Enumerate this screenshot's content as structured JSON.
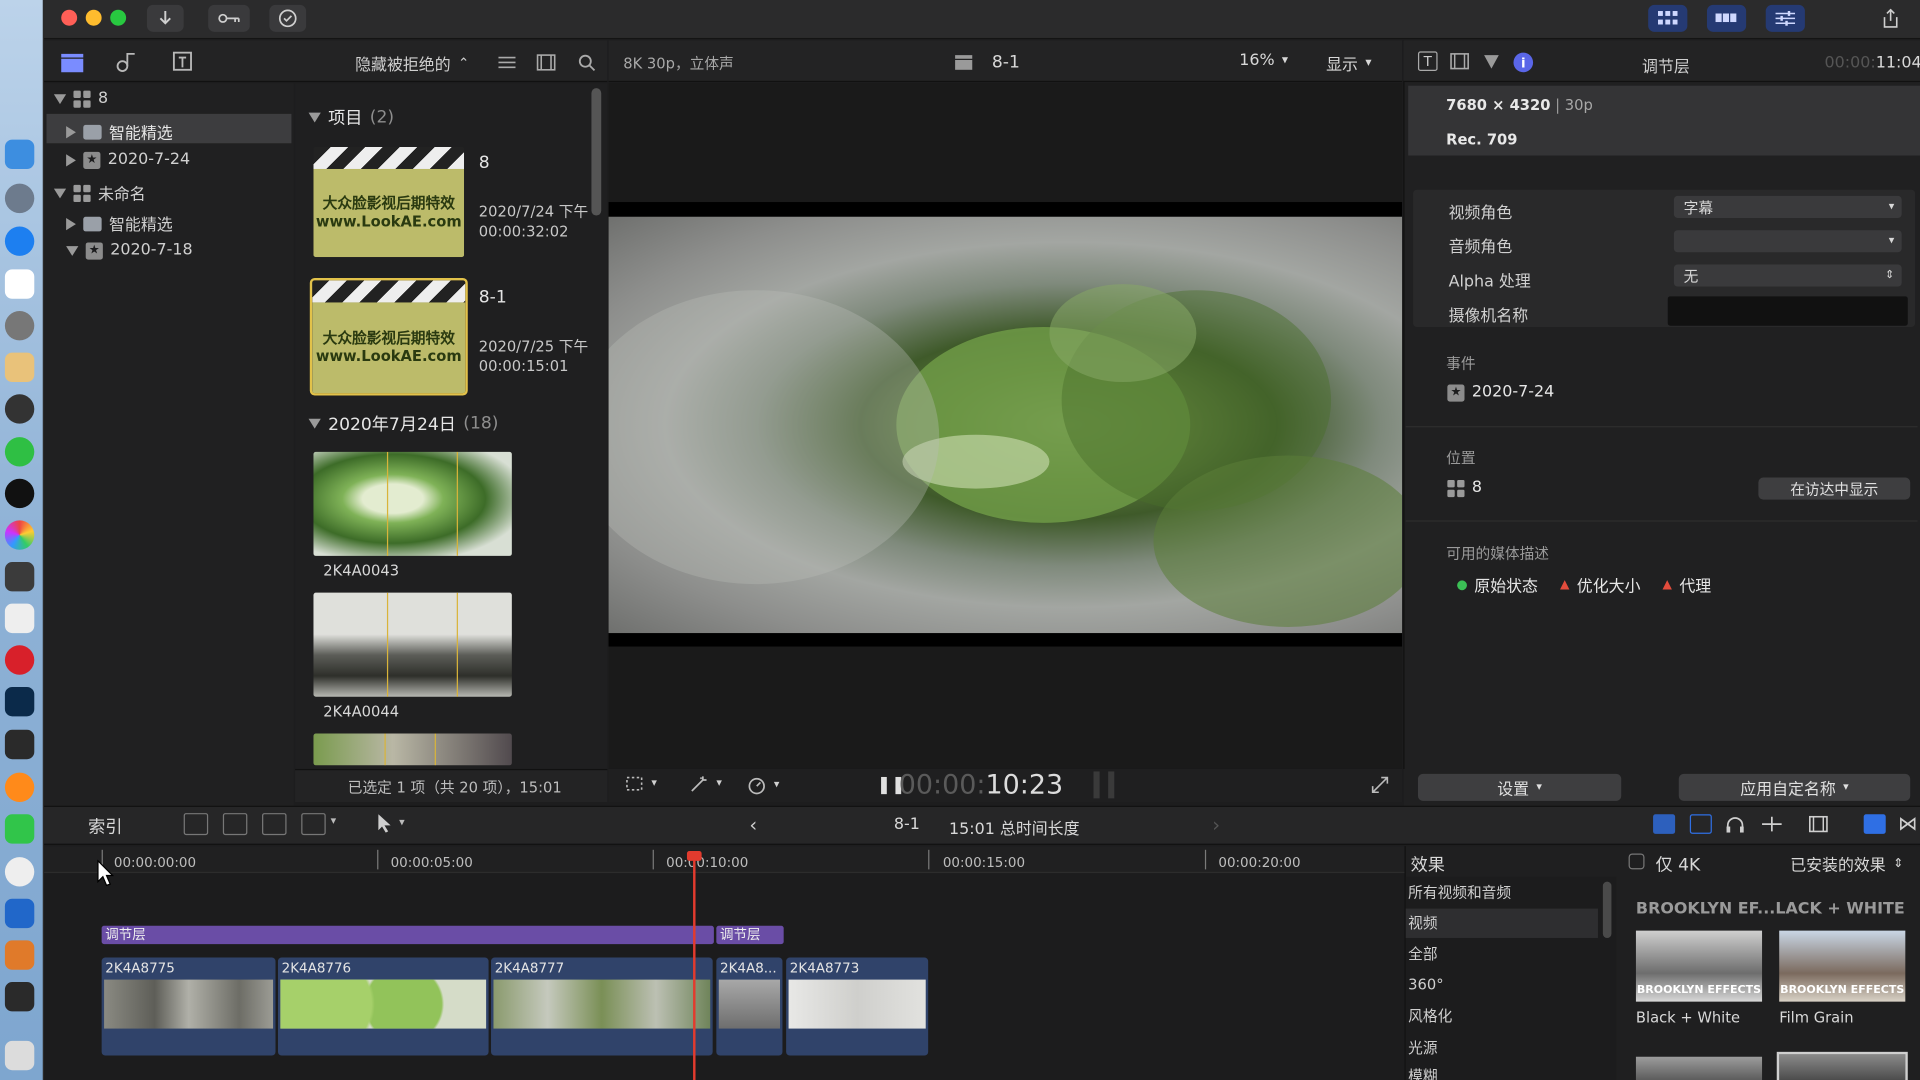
{
  "toolbar": {
    "clip_info": "8K 30p，立体声",
    "viewer_title": "8-1",
    "zoom": "16%",
    "display_label": "显示",
    "filter_label": "隐藏被拒绝的"
  },
  "library": {
    "items": [
      {
        "label": "8",
        "icon": "library-grid-icon"
      },
      {
        "label": "智能精选",
        "icon": "folder-icon"
      },
      {
        "label": "2020-7-24",
        "icon": "event-star-icon"
      },
      {
        "label": "未命名",
        "icon": "library-grid-icon"
      },
      {
        "label": "智能精选",
        "icon": "folder-icon"
      },
      {
        "label": "2020-7-18",
        "icon": "event-star-icon"
      }
    ]
  },
  "browser": {
    "projects_header": "项目",
    "projects_count": "(2)",
    "projects": [
      {
        "name": "8",
        "date": "2020/7/24 下午",
        "duration": "00:00:32:02",
        "poster_line1": "大众脸影视后期特效",
        "poster_line2": "www.LookAE.com"
      },
      {
        "name": "8-1",
        "date": "2020/7/25 下午",
        "duration": "00:00:15:01",
        "poster_line1": "大众脸影视后期特效",
        "poster_line2": "www.LookAE.com"
      }
    ],
    "date_header": "2020年7月24日",
    "date_count": "(18)",
    "clips": [
      {
        "name": "2K4A0043"
      },
      {
        "name": "2K4A0044"
      }
    ],
    "status": "已选定 1 项（共 20 项），15:01"
  },
  "viewer": {
    "timecode_dim": "00:00:",
    "timecode": "10:23"
  },
  "inspector": {
    "title": "调节层",
    "time_dim": "00:00:",
    "time": "11:04",
    "resolution": "7680 × 4320",
    "framerate": "30p",
    "colorspace": "Rec. 709",
    "video_role_label": "视频角色",
    "video_role_value": "字幕",
    "audio_role_label": "音频角色",
    "audio_role_value": "",
    "alpha_label": "Alpha 处理",
    "alpha_value": "无",
    "camera_label": "摄像机名称",
    "camera_value": "",
    "event_label": "事件",
    "event_value": "2020-7-24",
    "location_label": "位置",
    "location_value": "8",
    "reveal_button": "在访达中显示",
    "media_label": "可用的媒体描述",
    "media_original": "原始状态",
    "media_optimized": "优化大小",
    "media_proxy": "代理",
    "settings_button": "设置",
    "apply_name_button": "应用自定名称"
  },
  "timeline": {
    "index_label": "索引",
    "project_name": "8-1",
    "duration_text": "15:01 总时间长度",
    "ruler": [
      "00:00:00:00",
      "00:00:05:00",
      "00:00:10:00",
      "00:00:15:00",
      "00:00:20:00"
    ],
    "adjustment_clips": [
      "调节层",
      "调节层"
    ],
    "clips": [
      "2K4A8775",
      "2K4A8776",
      "2K4A8777",
      "2K4A8...",
      "2K4A8773"
    ]
  },
  "effects": {
    "header": "效果",
    "only_4k": "仅 4K",
    "installed": "已安装的效果",
    "categories": [
      "所有视频和音频",
      "视频",
      "全部",
      "360°",
      "风格化",
      "光源",
      "模糊"
    ],
    "group_title": "BROOKLYN EF...LACK + WHITE",
    "thumb_text": "BROOKLYN EFFECTS",
    "items": [
      {
        "name": "Black + White"
      },
      {
        "name": "Film Grain"
      }
    ]
  },
  "colors": {
    "accent": "#2f6fe4",
    "selection_yellow": "#e2c24a",
    "adjustment_purple": "#6a4da6",
    "clip_blue": "#30436a",
    "playhead": "#e23b2e"
  }
}
